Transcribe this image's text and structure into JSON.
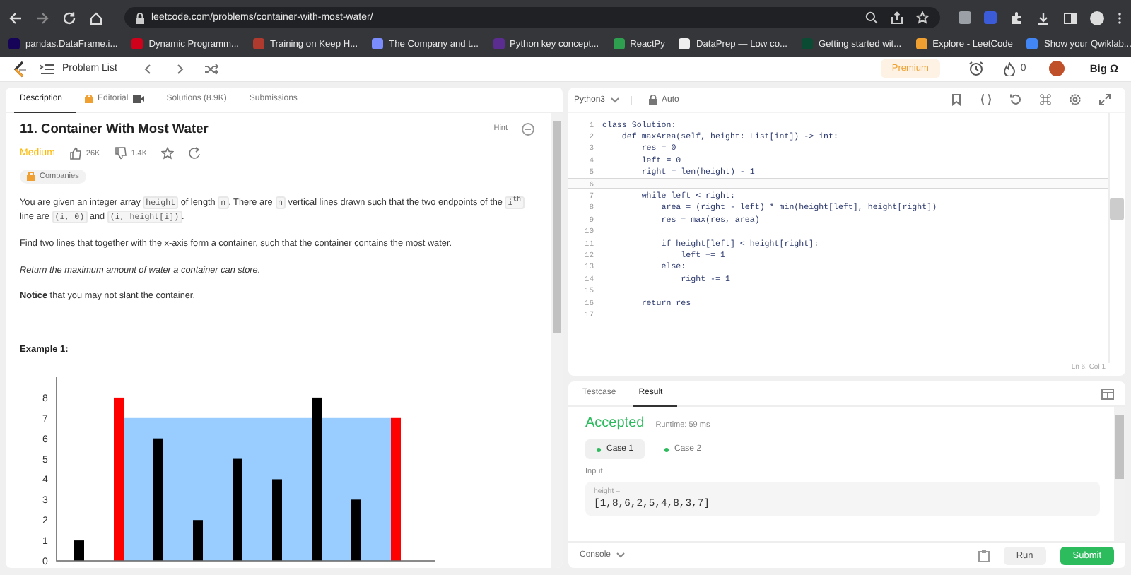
{
  "browser": {
    "url": "leetcode.com/problems/container-with-most-water/",
    "bookmarks": [
      {
        "label": "pandas.DataFrame.i...",
        "color": "#150458"
      },
      {
        "label": "Dynamic Programm...",
        "color": "#d0021b"
      },
      {
        "label": "Training on Keep H...",
        "color": "#b03a2e"
      },
      {
        "label": "The Company and t...",
        "color": "#7b8cff"
      },
      {
        "label": "Python key concept...",
        "color": "#5b2d91"
      },
      {
        "label": "ReactPy",
        "color": "#2e9e4f"
      },
      {
        "label": "DataPrep — Low co...",
        "color": "#eeeeee"
      },
      {
        "label": "Getting started wit...",
        "color": "#0c4b33"
      },
      {
        "label": "Explore - LeetCode",
        "color": "#f0a030"
      },
      {
        "label": "Show your Qwiklab...",
        "color": "#4285f4"
      }
    ]
  },
  "nav": {
    "problem_list": "Problem List",
    "premium": "Premium",
    "streak": "0",
    "user": "Big Ω"
  },
  "description": {
    "tabs": [
      {
        "label": "Description",
        "selected": true,
        "kind": "plain"
      },
      {
        "label": "Editorial",
        "selected": false,
        "kind": "locked-video"
      },
      {
        "label": "Solutions (8.9K)",
        "selected": false,
        "kind": "plain"
      },
      {
        "label": "Submissions",
        "selected": false,
        "kind": "plain"
      }
    ],
    "title": "11. Container With Most Water",
    "hint": "Hint",
    "difficulty": "Medium",
    "likes": "26K",
    "dislikes": "1.4K",
    "companies": "Companies",
    "paragraphs": [
      {
        "kind": "mixed",
        "parts": [
          {
            "kind": "text",
            "text": "You are given an integer array "
          },
          {
            "kind": "code",
            "text": "height"
          },
          {
            "kind": "text",
            "text": " of length "
          },
          {
            "kind": "code",
            "text": "n"
          },
          {
            "kind": "text",
            "text": ". There are "
          },
          {
            "kind": "code",
            "text": "n"
          },
          {
            "kind": "text",
            "text": " vertical lines drawn such that the two endpoints of the "
          },
          {
            "kind": "code",
            "text": "i$^{th}$"
          },
          {
            "kind": "text",
            "text": " line are "
          },
          {
            "kind": "code",
            "text": "(i, 0)"
          },
          {
            "kind": "text",
            "text": " and "
          },
          {
            "kind": "code",
            "text": "(i, height[i])"
          },
          {
            "kind": "text",
            "text": "."
          }
        ]
      },
      {
        "kind": "plain",
        "text": "Find two lines that together with the x-axis form a container, such that the container contains the most water."
      },
      {
        "kind": "italic",
        "text": "Return the maximum amount of water a container can store."
      },
      {
        "kind": "plain",
        "text": "**Notice** that you may not slant the container."
      }
    ],
    "example_title": "Example 1:",
    "chart_data": {
      "type": "bar",
      "ylim": [
        0,
        9
      ],
      "yticks": [
        0,
        1,
        2,
        3,
        4,
        5,
        6,
        7,
        8
      ],
      "series": [
        {
          "color": "#000000",
          "values": [
            1,
            null,
            6,
            2,
            5,
            4,
            8,
            3,
            null
          ]
        },
        {
          "color": "#ff0000",
          "values": [
            null,
            8,
            null,
            null,
            null,
            null,
            null,
            null,
            7
          ]
        }
      ]
    }
  },
  "editor": {
    "language": "Python3",
    "mode": "Auto",
    "status": "Ln 6, Col 1",
    "lines": [
      {
        "number": "1",
        "text": "class Solution:",
        "selected": false
      },
      {
        "number": "2",
        "text": "    def maxArea(self, height: List[int]) -> int:",
        "selected": false
      },
      {
        "number": "3",
        "text": "        res = 0",
        "selected": false
      },
      {
        "number": "4",
        "text": "        left = 0",
        "selected": false
      },
      {
        "number": "5",
        "text": "        right = len(height) - 1",
        "selected": false
      },
      {
        "number": "6",
        "selected": true
      },
      {
        "number": "7",
        "text": "        while left < right:",
        "selected": false
      },
      {
        "number": "8",
        "text": "            area = (right - left) * min(height[left], height[right])",
        "selected": false
      },
      {
        "number": "9",
        "text": "            res = max(res, area)",
        "selected": false
      },
      {
        "number": "10",
        "selected": false
      },
      {
        "number": "11",
        "text": "            if height[left] < height[right]:",
        "selected": false
      },
      {
        "number": "12",
        "text": "                left += 1",
        "selected": false
      },
      {
        "number": "13",
        "text": "            else:",
        "selected": false
      },
      {
        "number": "14",
        "text": "                right -= 1",
        "selected": false
      },
      {
        "number": "15",
        "selected": false
      },
      {
        "number": "16",
        "text": "        return res",
        "selected": false
      },
      {
        "number": "17",
        "selected": false
      }
    ]
  },
  "result": {
    "tabs": [
      {
        "label": "Testcase",
        "selected": false
      },
      {
        "label": "Result",
        "selected": true
      }
    ],
    "verdict": "Accepted",
    "runtime": "Runtime: 59 ms",
    "cases": [
      {
        "label": "Case 1",
        "selected": true
      },
      {
        "label": "Case 2",
        "selected": false
      }
    ],
    "input_label": "Input",
    "variable": "height =",
    "value": "[1,8,6,2,5,4,8,3,7]"
  },
  "footer": {
    "console": "Console",
    "run": "Run",
    "submit": "Submit"
  }
}
